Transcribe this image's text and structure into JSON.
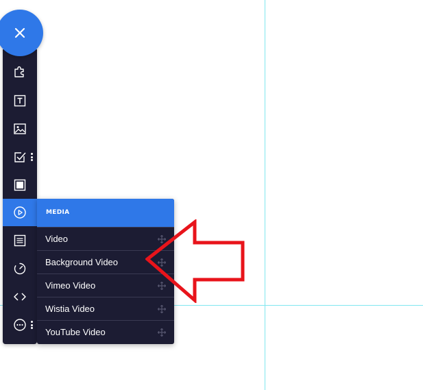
{
  "colors": {
    "accent": "#2f78e8",
    "toolbar_bg": "#1c1c33",
    "guide_line": "#7fe7ef",
    "annotation_arrow": "#e8141b"
  },
  "close_button": {
    "icon": "close-icon"
  },
  "toolbar": {
    "tools": [
      {
        "name": "puzzle-icon"
      },
      {
        "name": "text-box-icon"
      },
      {
        "name": "image-icon"
      },
      {
        "name": "checkbox-icon",
        "has_menu": true
      },
      {
        "name": "square-block-icon"
      },
      {
        "name": "play-circle-icon",
        "active": true
      },
      {
        "name": "list-doc-icon"
      },
      {
        "name": "timer-icon"
      },
      {
        "name": "code-icon"
      },
      {
        "name": "more-circle-icon",
        "has_menu": true
      }
    ]
  },
  "media_panel": {
    "header": "MEDIA",
    "items": [
      {
        "label": "Video"
      },
      {
        "label": "Background Video"
      },
      {
        "label": "Vimeo Video"
      },
      {
        "label": "Wistia Video"
      },
      {
        "label": "YouTube Video"
      }
    ]
  }
}
